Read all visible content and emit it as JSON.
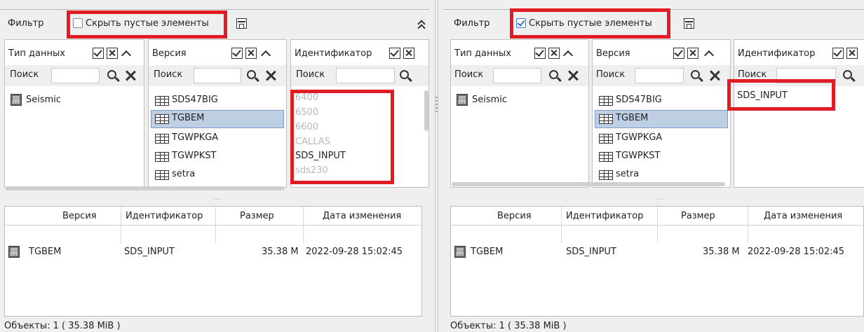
{
  "filter_label": "Фильтр",
  "hide_empty_label": "Скрыть пустые элементы",
  "panels": {
    "data_type": {
      "title": "Тип данных",
      "items": [
        "Seismic"
      ]
    },
    "version": {
      "title": "Версия",
      "items": [
        "SDS47BIG",
        "TGBEM",
        "TGWPKGA",
        "TGWPKST",
        "setra"
      ],
      "selected": "TGBEM"
    },
    "identifier": {
      "title": "Идентификатор"
    }
  },
  "search_label": "Поиск",
  "left": {
    "hide_empty_checked": false,
    "identifier_items": [
      {
        "text": "6400",
        "state": "disabled"
      },
      {
        "text": "6500",
        "state": "disabled"
      },
      {
        "text": "6600",
        "state": "disabled"
      },
      {
        "text": "CALLAS",
        "state": "disabled"
      },
      {
        "text": "SDS_INPUT",
        "state": "enabled"
      },
      {
        "text": "sds230",
        "state": "disabled"
      }
    ]
  },
  "right": {
    "hide_empty_checked": true,
    "identifier_items": [
      {
        "text": "SDS_INPUT",
        "state": "enabled"
      }
    ]
  },
  "table": {
    "columns": [
      "Версия",
      "Идентификатор",
      "Размер",
      "Дата изменения"
    ],
    "rows": [
      {
        "version": "TGBEM",
        "identifier": "SDS_INPUT",
        "size": "35.38 M",
        "modified": "2022-09-28 15:02:45"
      }
    ]
  },
  "status": "Объекты: 1 ( 35.38 MiB )",
  "splitter_dots": "...",
  "colors": {
    "highlight": "#e01c24",
    "selection": "#bfcfe3",
    "checkbox_accent": "#2f6fd1"
  }
}
